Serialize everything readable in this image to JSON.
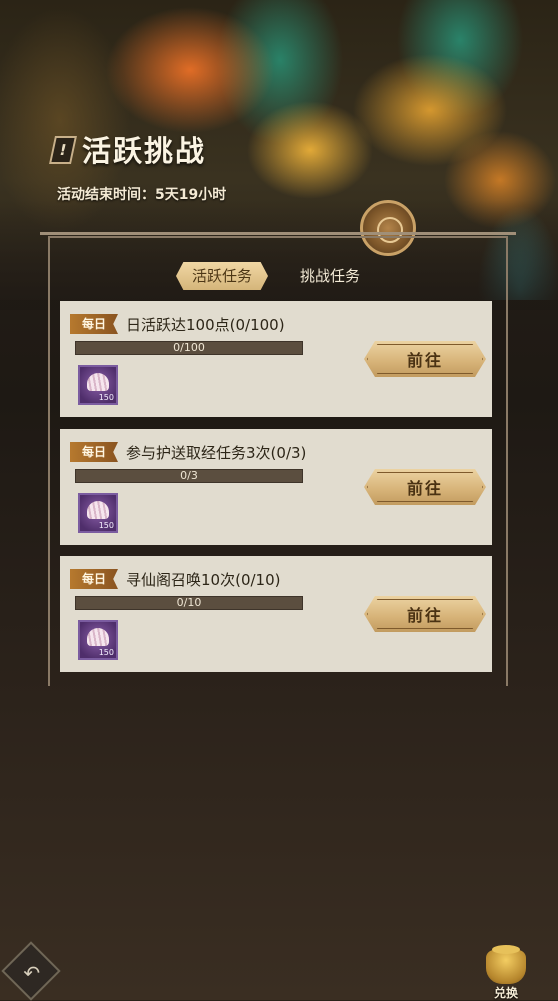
{
  "header": {
    "title": "活跃挑战",
    "title_icon": "!",
    "timer": "活动结束时间：5天19小时"
  },
  "tabs": [
    {
      "label": "活跃任务",
      "active": true
    },
    {
      "label": "挑战任务",
      "active": false
    }
  ],
  "tasks": [
    {
      "badge": "每日",
      "name": "日活跃达100点(0/100)",
      "progress_text": "0/100",
      "progress": 0,
      "reward_count": "150",
      "button": "前往"
    },
    {
      "badge": "每日",
      "name": "参与护送取经任务3次(0/3)",
      "progress_text": "0/3",
      "progress": 0,
      "reward_count": "150",
      "button": "前往"
    },
    {
      "badge": "每日",
      "name": "寻仙阁召唤10次(0/10)",
      "progress_text": "0/10",
      "progress": 0,
      "reward_count": "150",
      "button": "前往"
    }
  ],
  "bottom": {
    "back_icon": "↶",
    "exchange_label": "兑换"
  },
  "colors": {
    "accent_gold": "#d6b277",
    "card_bg": "#e1dccf",
    "badge": "#b6792e",
    "reward_purple": "#6b4488"
  }
}
